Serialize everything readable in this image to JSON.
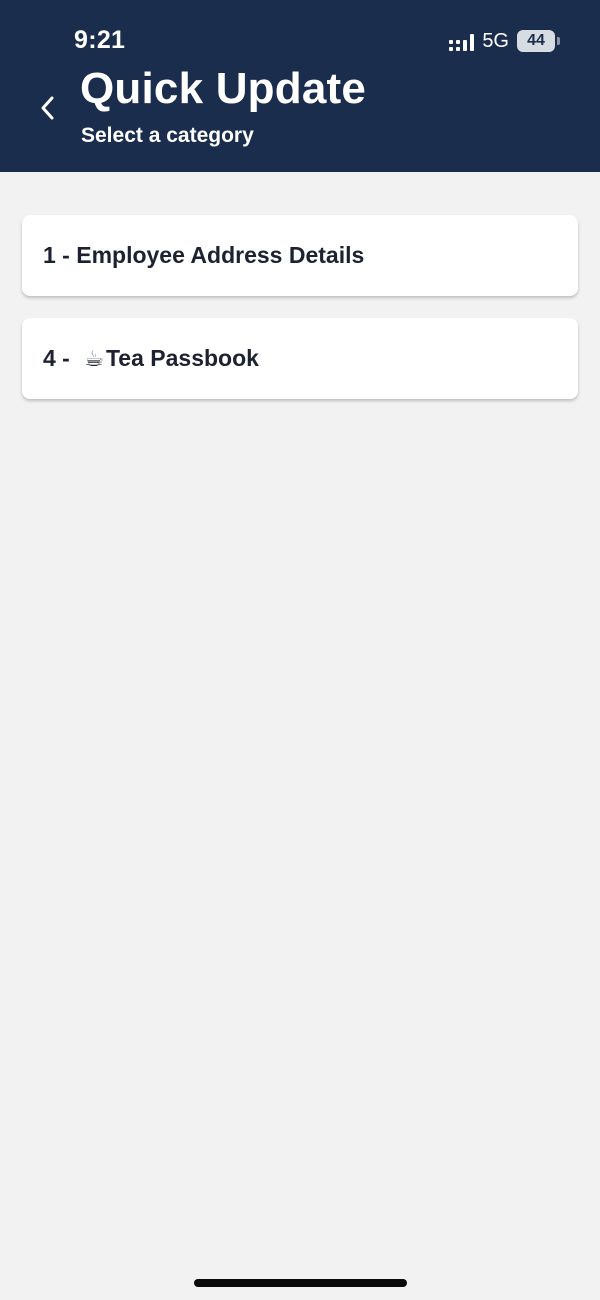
{
  "status_bar": {
    "time": "9:21",
    "network": "5G",
    "battery": "44"
  },
  "header": {
    "title": "Quick Update",
    "subtitle": "Select a category",
    "back_icon": "chevron-left-icon"
  },
  "categories": [
    {
      "prefix": "1 - ",
      "emoji": "",
      "label": "Employee Address Details"
    },
    {
      "prefix": "4 - ",
      "emoji": "☕",
      "label": "Tea Passbook"
    }
  ],
  "colors": {
    "header_bg": "#1b2d4d",
    "page_bg": "#f2f2f2",
    "card_bg": "#ffffff",
    "card_text": "#1e2230"
  }
}
